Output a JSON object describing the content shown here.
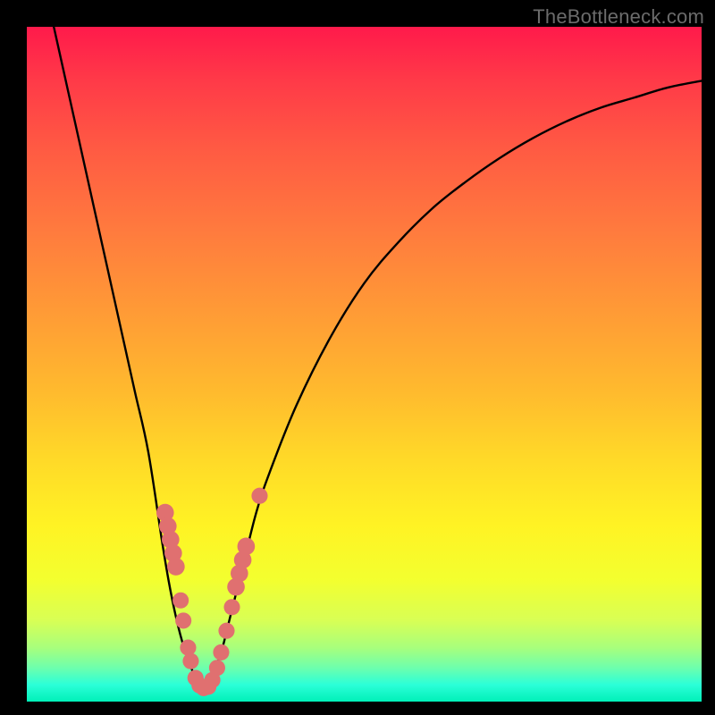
{
  "watermark": "TheBottleneck.com",
  "chart_data": {
    "type": "line",
    "title": "",
    "xlabel": "",
    "ylabel": "",
    "xlim": [
      0,
      100
    ],
    "ylim": [
      0,
      100
    ],
    "grid": false,
    "legend": false,
    "series": [
      {
        "name": "curve-left",
        "x": [
          4,
          6,
          8,
          10,
          12,
          14,
          16,
          18,
          20,
          21,
          22,
          23,
          24,
          25,
          26
        ],
        "y": [
          100,
          91,
          82,
          73,
          64,
          55,
          46,
          37,
          24,
          18,
          13,
          9,
          6,
          3.5,
          2
        ]
      },
      {
        "name": "curve-right",
        "x": [
          26,
          27,
          28,
          29,
          30,
          32,
          34,
          36,
          40,
          45,
          50,
          55,
          60,
          65,
          70,
          75,
          80,
          85,
          90,
          95,
          100
        ],
        "y": [
          2,
          3,
          5,
          8,
          12,
          20,
          28,
          34,
          44,
          54,
          62,
          68,
          73,
          77,
          80.5,
          83.5,
          86,
          88,
          89.5,
          91,
          92
        ]
      }
    ],
    "markers": [
      {
        "x": 20.5,
        "y": 28,
        "r": 1.3
      },
      {
        "x": 20.9,
        "y": 26,
        "r": 1.3
      },
      {
        "x": 21.3,
        "y": 24,
        "r": 1.3
      },
      {
        "x": 21.7,
        "y": 22,
        "r": 1.3
      },
      {
        "x": 22.1,
        "y": 20,
        "r": 1.3
      },
      {
        "x": 22.8,
        "y": 15,
        "r": 1.2
      },
      {
        "x": 23.2,
        "y": 12,
        "r": 1.2
      },
      {
        "x": 23.9,
        "y": 8,
        "r": 1.2
      },
      {
        "x": 24.3,
        "y": 6,
        "r": 1.2
      },
      {
        "x": 25.0,
        "y": 3.5,
        "r": 1.2
      },
      {
        "x": 25.6,
        "y": 2.4,
        "r": 1.2
      },
      {
        "x": 26.2,
        "y": 2.0,
        "r": 1.2
      },
      {
        "x": 26.9,
        "y": 2.2,
        "r": 1.2
      },
      {
        "x": 27.5,
        "y": 3.2,
        "r": 1.2
      },
      {
        "x": 28.2,
        "y": 5.0,
        "r": 1.2
      },
      {
        "x": 28.8,
        "y": 7.3,
        "r": 1.2
      },
      {
        "x": 29.6,
        "y": 10.5,
        "r": 1.2
      },
      {
        "x": 30.4,
        "y": 14,
        "r": 1.2
      },
      {
        "x": 31.0,
        "y": 17,
        "r": 1.3
      },
      {
        "x": 31.5,
        "y": 19,
        "r": 1.3
      },
      {
        "x": 32.0,
        "y": 21,
        "r": 1.3
      },
      {
        "x": 32.5,
        "y": 23,
        "r": 1.3
      },
      {
        "x": 34.5,
        "y": 30.5,
        "r": 1.2
      }
    ],
    "colors": {
      "curve": "#000000",
      "marker": "#e07070",
      "gradient_top": "#ff1a4b",
      "gradient_bottom": "#00f0b8"
    }
  }
}
